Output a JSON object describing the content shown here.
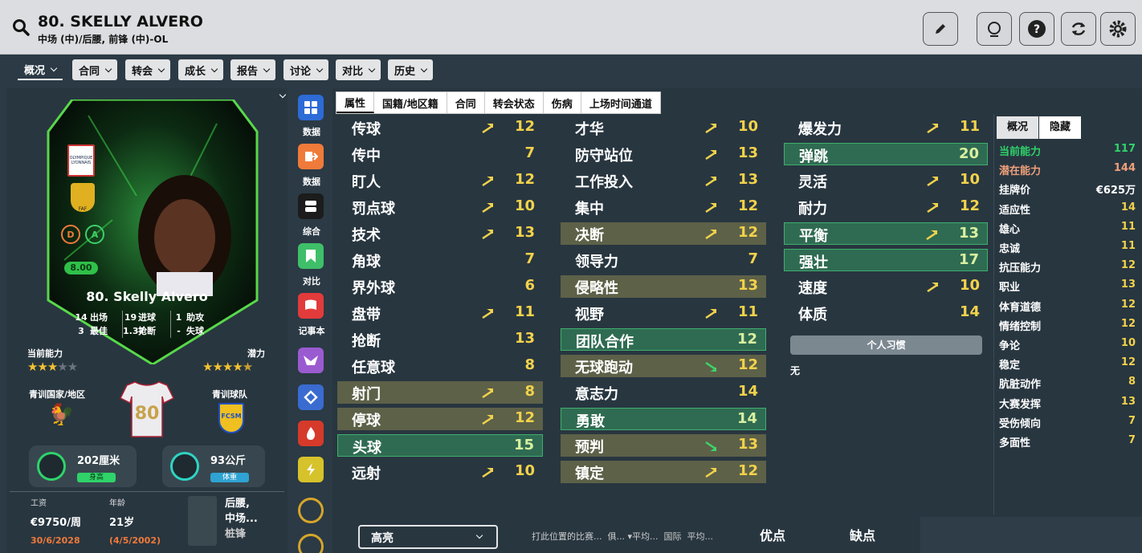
{
  "header": {
    "title": "80. SKELLY ALVERO",
    "subtitle": "中场 (中)/后腰, 前锋 (中)-OL"
  },
  "tabs": [
    {
      "label": "概况"
    },
    {
      "label": "合同"
    },
    {
      "label": "转会"
    },
    {
      "label": "成长"
    },
    {
      "label": "报告"
    },
    {
      "label": "讨论"
    },
    {
      "label": "对比"
    },
    {
      "label": "历史"
    }
  ],
  "card": {
    "name": "80. Skelly Alvero",
    "rating": "8.00",
    "club_logo_text": "OLYMPIQUE LYONNAIS",
    "badge_text": "FAF",
    "stats": [
      {
        "v": "14",
        "l": "出场"
      },
      {
        "v": "19",
        "l": "进球"
      },
      {
        "v": "1",
        "l": "助攻"
      },
      {
        "v": "3",
        "l": "最佳"
      },
      {
        "v": "1.37",
        "l": "抢断"
      },
      {
        "v": "-",
        "l": "失球"
      }
    ],
    "ca_label": "当前能力",
    "pa_label": "潜力",
    "ca_stars": 3,
    "pa_stars": 4.5,
    "nation_label": "青训国家/地区",
    "club_label": "青训球队",
    "shirt_number": "80",
    "club_badge_text": "FCSM"
  },
  "physical": {
    "height": "202厘米",
    "height_label": "身高",
    "weight": "93公斤",
    "weight_label": "体重"
  },
  "contract": {
    "wage_label": "工资",
    "wage": "€9750/周",
    "expiry": "30/6/2028",
    "age_label": "年龄",
    "age": "21岁",
    "dob": "(4/5/2002)",
    "positions": "后腰,\n中场...",
    "positions_2": "桩锋"
  },
  "side_icons": [
    {
      "label": "数据",
      "color": "#2d6bd6"
    },
    {
      "label": "数据",
      "color": "#f07a3a"
    },
    {
      "label": "综合",
      "color": "#1c1c1c"
    },
    {
      "label": "对比",
      "color": "#3fbf6a"
    },
    {
      "label": "记事本",
      "color": "#e23b3b"
    },
    {
      "label": "",
      "color": "#9b5bd0"
    },
    {
      "label": "",
      "color": "#3a6bd0"
    },
    {
      "label": "",
      "color": "#d63a2a"
    },
    {
      "label": "",
      "color": "#d6c22a"
    },
    {
      "label": "",
      "color": "#d6a52a"
    }
  ],
  "subtabs": [
    "属性",
    "国籍/地区籍",
    "合同",
    "转会状态",
    "伤病",
    "上场时间通道"
  ],
  "attr_col1": [
    {
      "n": "传球",
      "v": "12",
      "a": "up"
    },
    {
      "n": "传中",
      "v": "7",
      "a": ""
    },
    {
      "n": "盯人",
      "v": "12",
      "a": "up"
    },
    {
      "n": "罚点球",
      "v": "10",
      "a": "up"
    },
    {
      "n": "技术",
      "v": "13",
      "a": "up"
    },
    {
      "n": "角球",
      "v": "7",
      "a": ""
    },
    {
      "n": "界外球",
      "v": "6",
      "a": ""
    },
    {
      "n": "盘带",
      "v": "11",
      "a": "up"
    },
    {
      "n": "抢断",
      "v": "13",
      "a": ""
    },
    {
      "n": "任意球",
      "v": "8",
      "a": ""
    },
    {
      "n": "射门",
      "v": "8",
      "a": "up",
      "hl": "o"
    },
    {
      "n": "停球",
      "v": "12",
      "a": "up",
      "hl": "o"
    },
    {
      "n": "头球",
      "v": "15",
      "a": "",
      "hl": "g"
    },
    {
      "n": "远射",
      "v": "10",
      "a": "up"
    }
  ],
  "attr_col2": [
    {
      "n": "才华",
      "v": "10",
      "a": "up"
    },
    {
      "n": "防守站位",
      "v": "13",
      "a": "up"
    },
    {
      "n": "工作投入",
      "v": "13",
      "a": "up"
    },
    {
      "n": "集中",
      "v": "12",
      "a": "up"
    },
    {
      "n": "决断",
      "v": "12",
      "a": "up",
      "hl": "o"
    },
    {
      "n": "领导力",
      "v": "7",
      "a": ""
    },
    {
      "n": "侵略性",
      "v": "13",
      "a": "",
      "hl": "o"
    },
    {
      "n": "视野",
      "v": "11",
      "a": "up"
    },
    {
      "n": "团队合作",
      "v": "12",
      "a": "",
      "hl": "g"
    },
    {
      "n": "无球跑动",
      "v": "12",
      "a": "dn",
      "hl": "o"
    },
    {
      "n": "意志力",
      "v": "14",
      "a": ""
    },
    {
      "n": "勇敢",
      "v": "14",
      "a": "",
      "hl": "g"
    },
    {
      "n": "预判",
      "v": "13",
      "a": "dn",
      "hl": "o"
    },
    {
      "n": "镇定",
      "v": "12",
      "a": "up",
      "hl": "o"
    }
  ],
  "attr_col3": [
    {
      "n": "爆发力",
      "v": "11",
      "a": "up"
    },
    {
      "n": "弹跳",
      "v": "20",
      "a": "",
      "hl": "g"
    },
    {
      "n": "灵活",
      "v": "10",
      "a": "up"
    },
    {
      "n": "耐力",
      "v": "12",
      "a": "up"
    },
    {
      "n": "平衡",
      "v": "13",
      "a": "up",
      "hl": "g"
    },
    {
      "n": "强壮",
      "v": "17",
      "a": "",
      "hl": "g"
    },
    {
      "n": "速度",
      "v": "10",
      "a": "up"
    },
    {
      "n": "体质",
      "v": "14",
      "a": ""
    }
  ],
  "habits": {
    "label": "个人习惯",
    "value": "无"
  },
  "right_panel": {
    "tabs": [
      "概况",
      "隐藏"
    ],
    "items": [
      {
        "n": "当前能力",
        "v": "117",
        "c": "#2fd36a"
      },
      {
        "n": "潜在能力",
        "v": "144",
        "c": "#f0a07a"
      },
      {
        "n": "挂牌价",
        "v": "€625万",
        "c": "#fff"
      },
      {
        "n": "适应性",
        "v": "14"
      },
      {
        "n": "雄心",
        "v": "11"
      },
      {
        "n": "忠诚",
        "v": "11"
      },
      {
        "n": "抗压能力",
        "v": "12"
      },
      {
        "n": "职业",
        "v": "13"
      },
      {
        "n": "体育道德",
        "v": "12"
      },
      {
        "n": "情绪控制",
        "v": "12"
      },
      {
        "n": "争论",
        "v": "10"
      },
      {
        "n": "稳定",
        "v": "12"
      },
      {
        "n": "肮脏动作",
        "v": "8"
      },
      {
        "n": "大赛发挥",
        "v": "13"
      },
      {
        "n": "受伤倾向",
        "v": "7"
      },
      {
        "n": "多面性",
        "v": "7"
      }
    ]
  },
  "bottom": {
    "dropdown": "高亮",
    "table_header": "打此位置的比赛...  俱... ▾平均...  国际  平均...",
    "pros": "优点",
    "cons": "缺点"
  }
}
